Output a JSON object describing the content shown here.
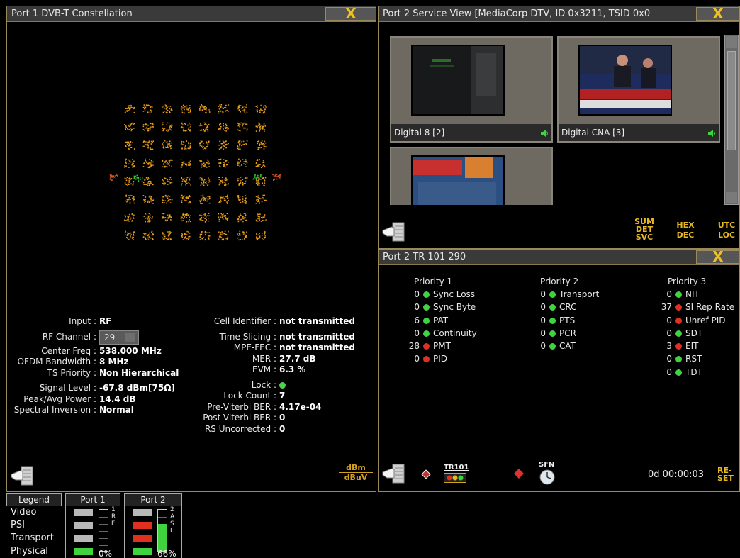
{
  "port1": {
    "title": "Port 1 DVB-T Constellation",
    "close_glyph": "X",
    "left_info": [
      {
        "label": "Input :",
        "value": "RF"
      },
      {
        "label": "RF Channel :",
        "value": "29",
        "select": true
      },
      {
        "label": "Center Freq :",
        "value": "538.000 MHz"
      },
      {
        "label": "OFDM Bandwidth :",
        "value": "8 MHz"
      },
      {
        "label": "TS Priority :",
        "value": "Non Hierarchical"
      },
      {
        "label": "Signal Level :",
        "value": "-67.8 dBm[75Ω]"
      },
      {
        "label": "Peak/Avg Power :",
        "value": "14.4 dB"
      },
      {
        "label": "Spectral Inversion :",
        "value": "Normal"
      }
    ],
    "right_info": [
      {
        "label": "Cell Identifier :",
        "value": "not transmitted"
      },
      {
        "label": "Time Slicing :",
        "value": "not transmitted"
      },
      {
        "label": "MPE-FEC :",
        "value": "not transmitted"
      },
      {
        "label": "MER :",
        "value": "27.7 dB"
      },
      {
        "label": "EVM :",
        "value": "6.3 %"
      },
      {
        "label": "Lock :",
        "value": ""
      },
      {
        "label": "Lock Count :",
        "value": "7"
      },
      {
        "label": "Pre-Viterbi BER :",
        "value": "4.17e-04"
      },
      {
        "label": "Post-Viterbi BER :",
        "value": "0"
      },
      {
        "label": "RS Uncorrected :",
        "value": "0"
      }
    ],
    "unit_top": "dBm",
    "unit_bottom": "dBuV"
  },
  "port2_service": {
    "title": "Port 2 Service View  [MediaCorp DTV, ID 0x3211, TSID 0x0",
    "close_glyph": "X",
    "services": [
      {
        "name": "Digital 8 [2]"
      },
      {
        "name": "Digital CNA [3]"
      },
      {
        "name": ""
      }
    ],
    "format_buttons": [
      {
        "lines": [
          "SUM",
          "DET",
          "SVC"
        ]
      },
      {
        "lines": [
          "HEX",
          "DEC"
        ]
      },
      {
        "lines": [
          "UTC",
          "LOC"
        ]
      }
    ]
  },
  "port2_tr": {
    "title": "Port 2 TR 101 290",
    "close_glyph": "X",
    "priorities": [
      {
        "title": "Priority 1",
        "items": [
          {
            "count": "0",
            "status": "green",
            "name": "Sync Loss"
          },
          {
            "count": "0",
            "status": "green",
            "name": "Sync Byte"
          },
          {
            "count": "6",
            "status": "green",
            "name": "PAT"
          },
          {
            "count": "0",
            "status": "green",
            "name": "Continuity"
          },
          {
            "count": "28",
            "status": "red",
            "name": "PMT"
          },
          {
            "count": "0",
            "status": "red",
            "name": "PID"
          }
        ]
      },
      {
        "title": "Priority 2",
        "items": [
          {
            "count": "0",
            "status": "green",
            "name": "Transport"
          },
          {
            "count": "0",
            "status": "green",
            "name": "CRC"
          },
          {
            "count": "0",
            "status": "green",
            "name": "PTS"
          },
          {
            "count": "0",
            "status": "green",
            "name": "PCR"
          },
          {
            "count": "0",
            "status": "green",
            "name": "CAT"
          }
        ]
      },
      {
        "title": "Priority 3",
        "items": [
          {
            "count": "0",
            "status": "green",
            "name": "NIT"
          },
          {
            "count": "37",
            "status": "red",
            "name": "SI Rep Rate"
          },
          {
            "count": "0",
            "status": "red",
            "name": "Unref PID"
          },
          {
            "count": "0",
            "status": "green",
            "name": "SDT"
          },
          {
            "count": "3",
            "status": "red",
            "name": "EIT"
          },
          {
            "count": "0",
            "status": "green",
            "name": "RST"
          },
          {
            "count": "0",
            "status": "green",
            "name": "TDT"
          }
        ]
      }
    ],
    "tr101_label": "TR101",
    "sfn_label": "SFN",
    "timer": "0d 00:00:03",
    "reset_lines": [
      "RE-",
      "SET"
    ]
  },
  "legend": {
    "tabs": [
      "Legend",
      "Port 1",
      "Port 2"
    ],
    "rows": [
      "Video",
      "PSI",
      "Transport",
      "Physical"
    ],
    "port1": {
      "lamps": [
        "gray",
        "gray",
        "gray",
        "green"
      ],
      "percent": "0%",
      "level": 0,
      "side_chars": [
        "1",
        "R",
        "F"
      ]
    },
    "port2": {
      "lamps": [
        "gray",
        "red",
        "red",
        "green"
      ],
      "percent": "66%",
      "level": 0.66,
      "side_chars": [
        "2",
        "A",
        "S",
        "I"
      ]
    }
  }
}
